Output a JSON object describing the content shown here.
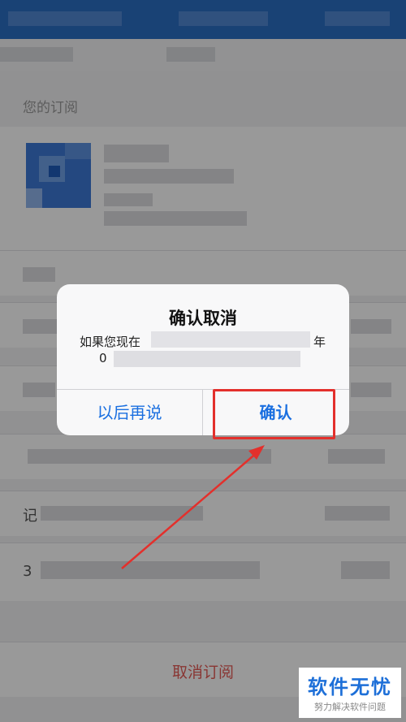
{
  "page": {
    "section_title": "您的订阅",
    "list_leads": [
      "记",
      "3"
    ],
    "cancel_subscription": "取消订阅"
  },
  "dialog": {
    "title": "确认取消",
    "message_start": "如果您现在",
    "message_end": "年",
    "message_line2_start": "0",
    "secondary_button": "以后再说",
    "primary_button": "确认"
  },
  "watermark": {
    "brand": "软件无忧",
    "tagline": "努力解决软件问题"
  },
  "colors": {
    "accent": "#1a6fe0",
    "destructive": "#e55a56",
    "annotation": "#e3302c",
    "header": "#2a6fc4"
  }
}
